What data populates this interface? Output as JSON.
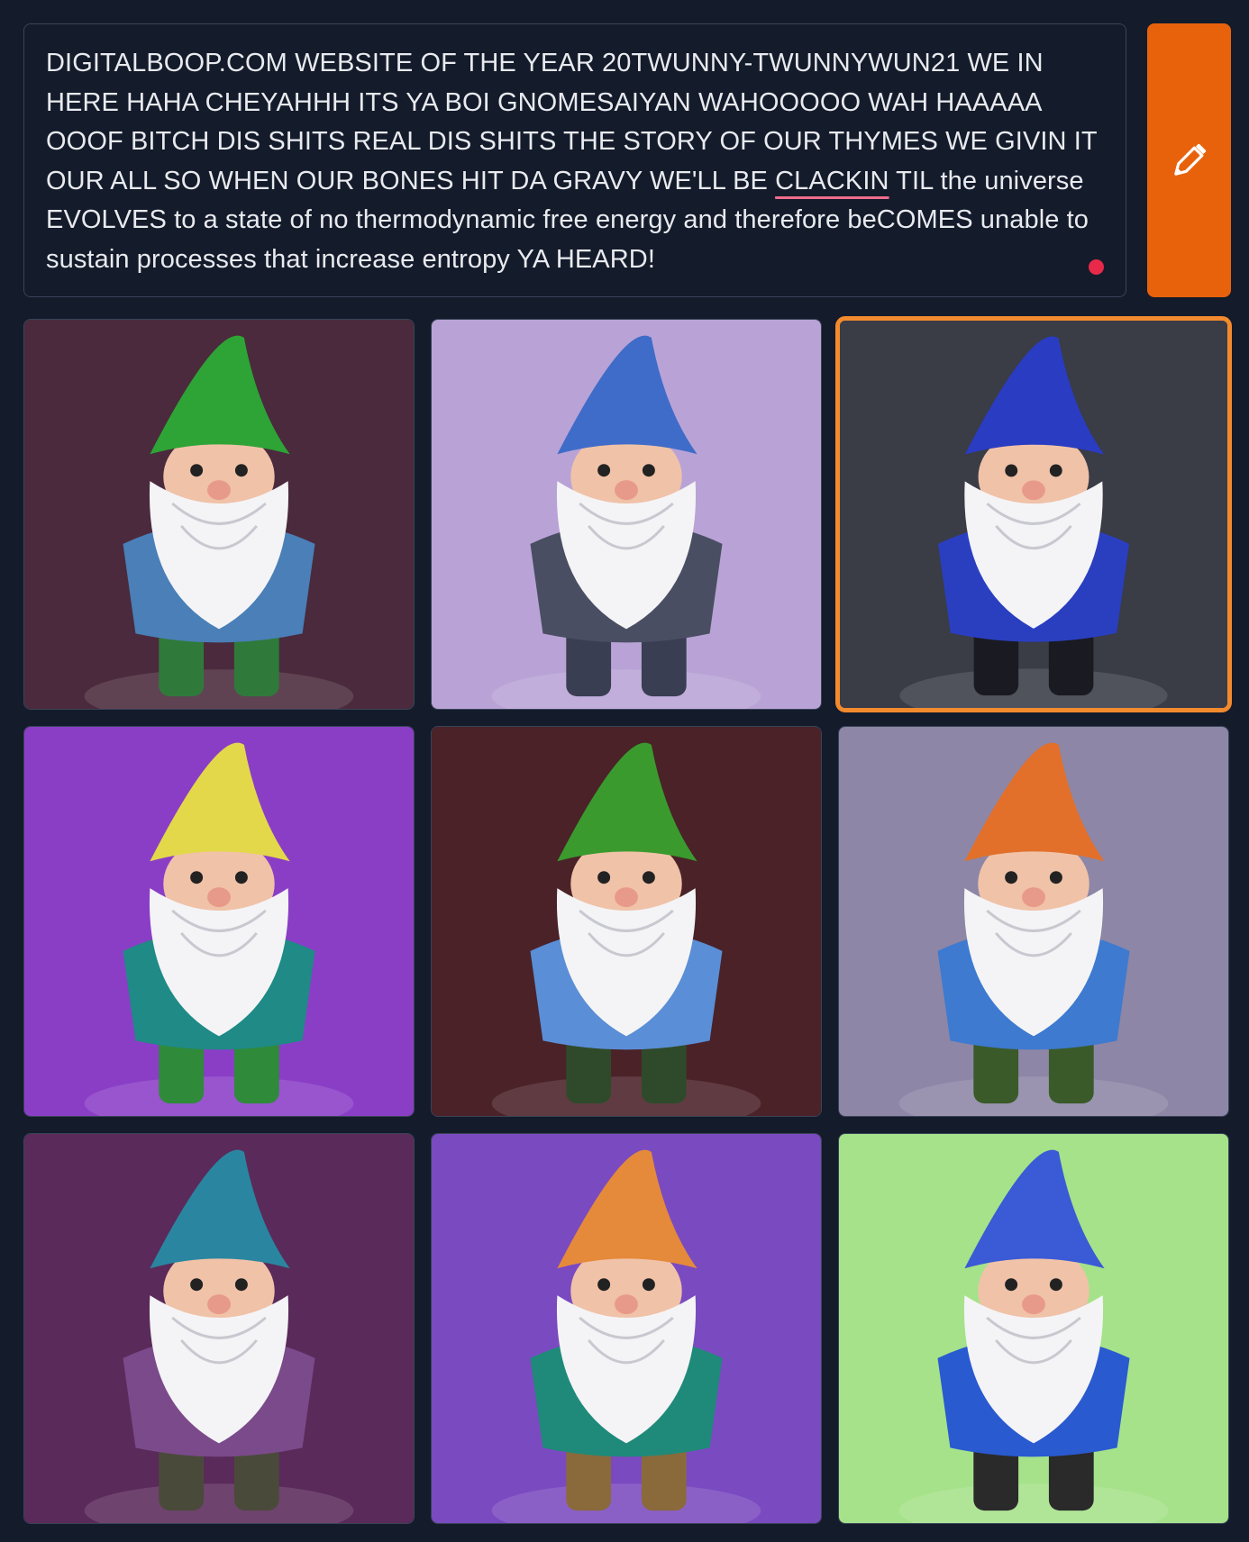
{
  "prompt": {
    "text_before": "DIGITALBOOP.COM WEBSITE OF THE YEAR 20TWUNNY-TWUNNYWUN21 WE IN HERE HAHA CHEYAHHH ITS YA BOI GNOMESAIYAN WAHOOOOO WAH HAAAAA OOOF BITCH DIS SHITS REAL DIS SHITS THE STORY OF OUR THYMES WE GIVIN IT OUR ALL SO WHEN OUR BONES HIT DA GRAVY WE'LL BE ",
    "misspelled_word": "CLACKIN",
    "text_after": " TIL the universe EVOLVES to a state of no thermodynamic free energy and therefore beCOMES unable to sustain processes that increase entropy YA HEARD!",
    "spellcheck_color": "#ef6c8c",
    "record_dot_color": "#e8294a"
  },
  "edit_button": {
    "icon": "pencil-icon",
    "color": "#e8620c"
  },
  "colors": {
    "background": "#141b2b",
    "border": "#3a4358",
    "selected_border": "#f28a2e"
  },
  "images": [
    {
      "hat": "#2ea336",
      "bg": "#4a2a3c",
      "shirt": "#4a7fb8",
      "pants": "#2f7a3a",
      "selected": false
    },
    {
      "hat": "#3f6cc8",
      "bg": "#b9a3d6",
      "shirt": "#4a4e63",
      "pants": "#3a3e52",
      "selected": false
    },
    {
      "hat": "#2a3cc2",
      "bg": "#3a3c46",
      "shirt": "#2a3fc0",
      "pants": "#1a1a22",
      "selected": true
    },
    {
      "hat": "#e3d84a",
      "bg": "#8a3ec6",
      "shirt": "#1f8a86",
      "pants": "#2f8a3a",
      "selected": false
    },
    {
      "hat": "#3a9a2e",
      "bg": "#4a2228",
      "shirt": "#5a8ed6",
      "pants": "#2f4a2a",
      "selected": false
    },
    {
      "hat": "#e2702a",
      "bg": "#8d86a6",
      "shirt": "#3d7ad0",
      "pants": "#3a5a2a",
      "selected": false
    },
    {
      "hat": "#2a86a0",
      "bg": "#5a2a5a",
      "shirt": "#7a4a8a",
      "pants": "#4a4a3a",
      "selected": false
    },
    {
      "hat": "#e48a3a",
      "bg": "#7a4ac0",
      "shirt": "#1f8a7a",
      "pants": "#8a6a3a",
      "selected": false
    },
    {
      "hat": "#3a5ad6",
      "bg": "#a6e28a",
      "shirt": "#2a5ad0",
      "pants": "#2a2a2a",
      "selected": false
    }
  ]
}
